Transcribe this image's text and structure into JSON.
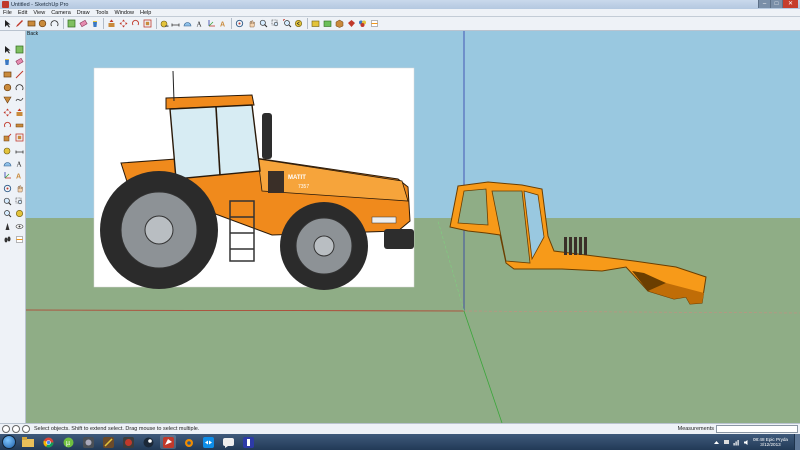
{
  "window": {
    "title": "Untitled - SketchUp Pro",
    "buttons": [
      "–",
      "□",
      "✕"
    ]
  },
  "menu": [
    "File",
    "Edit",
    "View",
    "Camera",
    "Draw",
    "Tools",
    "Window",
    "Help"
  ],
  "toolbar": {
    "icons": [
      "select-icon",
      "pencil-icon",
      "rectangle-icon",
      "circle-icon",
      "arc-icon",
      "make-component-icon",
      "eraser-icon",
      "paint-bucket-icon",
      "push-pull-icon",
      "move-icon",
      "rotate-icon",
      "offset-icon",
      "tape-measure-icon",
      "dimension-icon",
      "protractor-icon",
      "text-icon",
      "axes-icon",
      "3d-text-icon",
      "orbit-icon",
      "pan-icon",
      "zoom-icon",
      "zoom-window-icon",
      "zoom-extents-icon",
      "previous-icon",
      "get-models-icon",
      "share-model-icon",
      "components-icon",
      "extensions-icon",
      "styles-icon",
      "section-icon"
    ]
  },
  "scene": {
    "tab_label": "Back",
    "image_text_line1": "MATIT",
    "image_text_line2": "7357"
  },
  "status": {
    "text": "Select objects. Shift to extend select. Drag mouse to select multiple.",
    "measurements_label": "Measurements",
    "measurements_value": ""
  },
  "taskbar": {
    "apps": [
      "explorer",
      "chrome",
      "utorrent",
      "game-a",
      "game-b",
      "game-c",
      "steam",
      "sketchup",
      "blender",
      "teamviewer",
      "chat",
      "tool"
    ],
    "clock_time": "08:48  Epic Pryda",
    "clock_date": "3/12/2013"
  },
  "colors": {
    "sky": "#99c8e0",
    "ground": "#8fad86",
    "cab_orange": "#f79a19",
    "axis_red": "#b43a2a",
    "axis_green": "#3aa63a",
    "axis_blue": "#2d3aa8"
  }
}
